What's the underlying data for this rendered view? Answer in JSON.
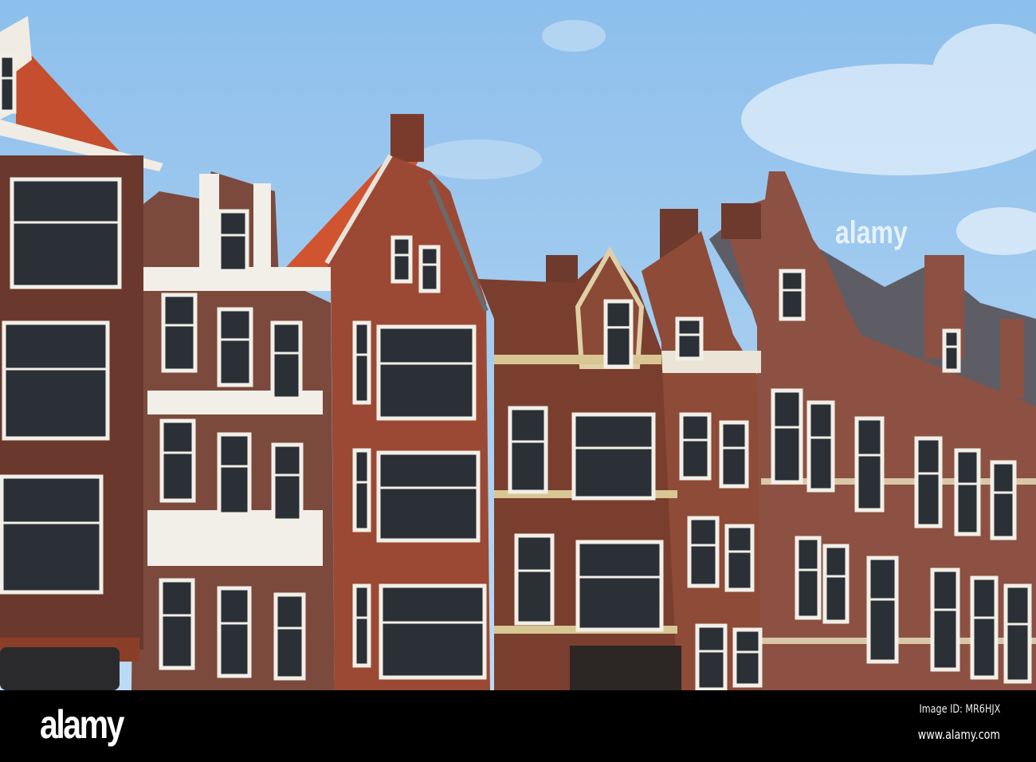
{
  "watermark": {
    "logo": "alamy",
    "overlay_logo": "alamy"
  },
  "footer": {
    "image_id": "Image ID: MR6HJX",
    "website": "www.alamy.com"
  },
  "colors": {
    "sky_top": "#8dbfec",
    "sky_bottom": "#bcdaf4",
    "brick_dark": "#6a382c",
    "brick_red": "#9b4934",
    "roof_tile": "#d0542f",
    "trim": "#f2efe8"
  }
}
